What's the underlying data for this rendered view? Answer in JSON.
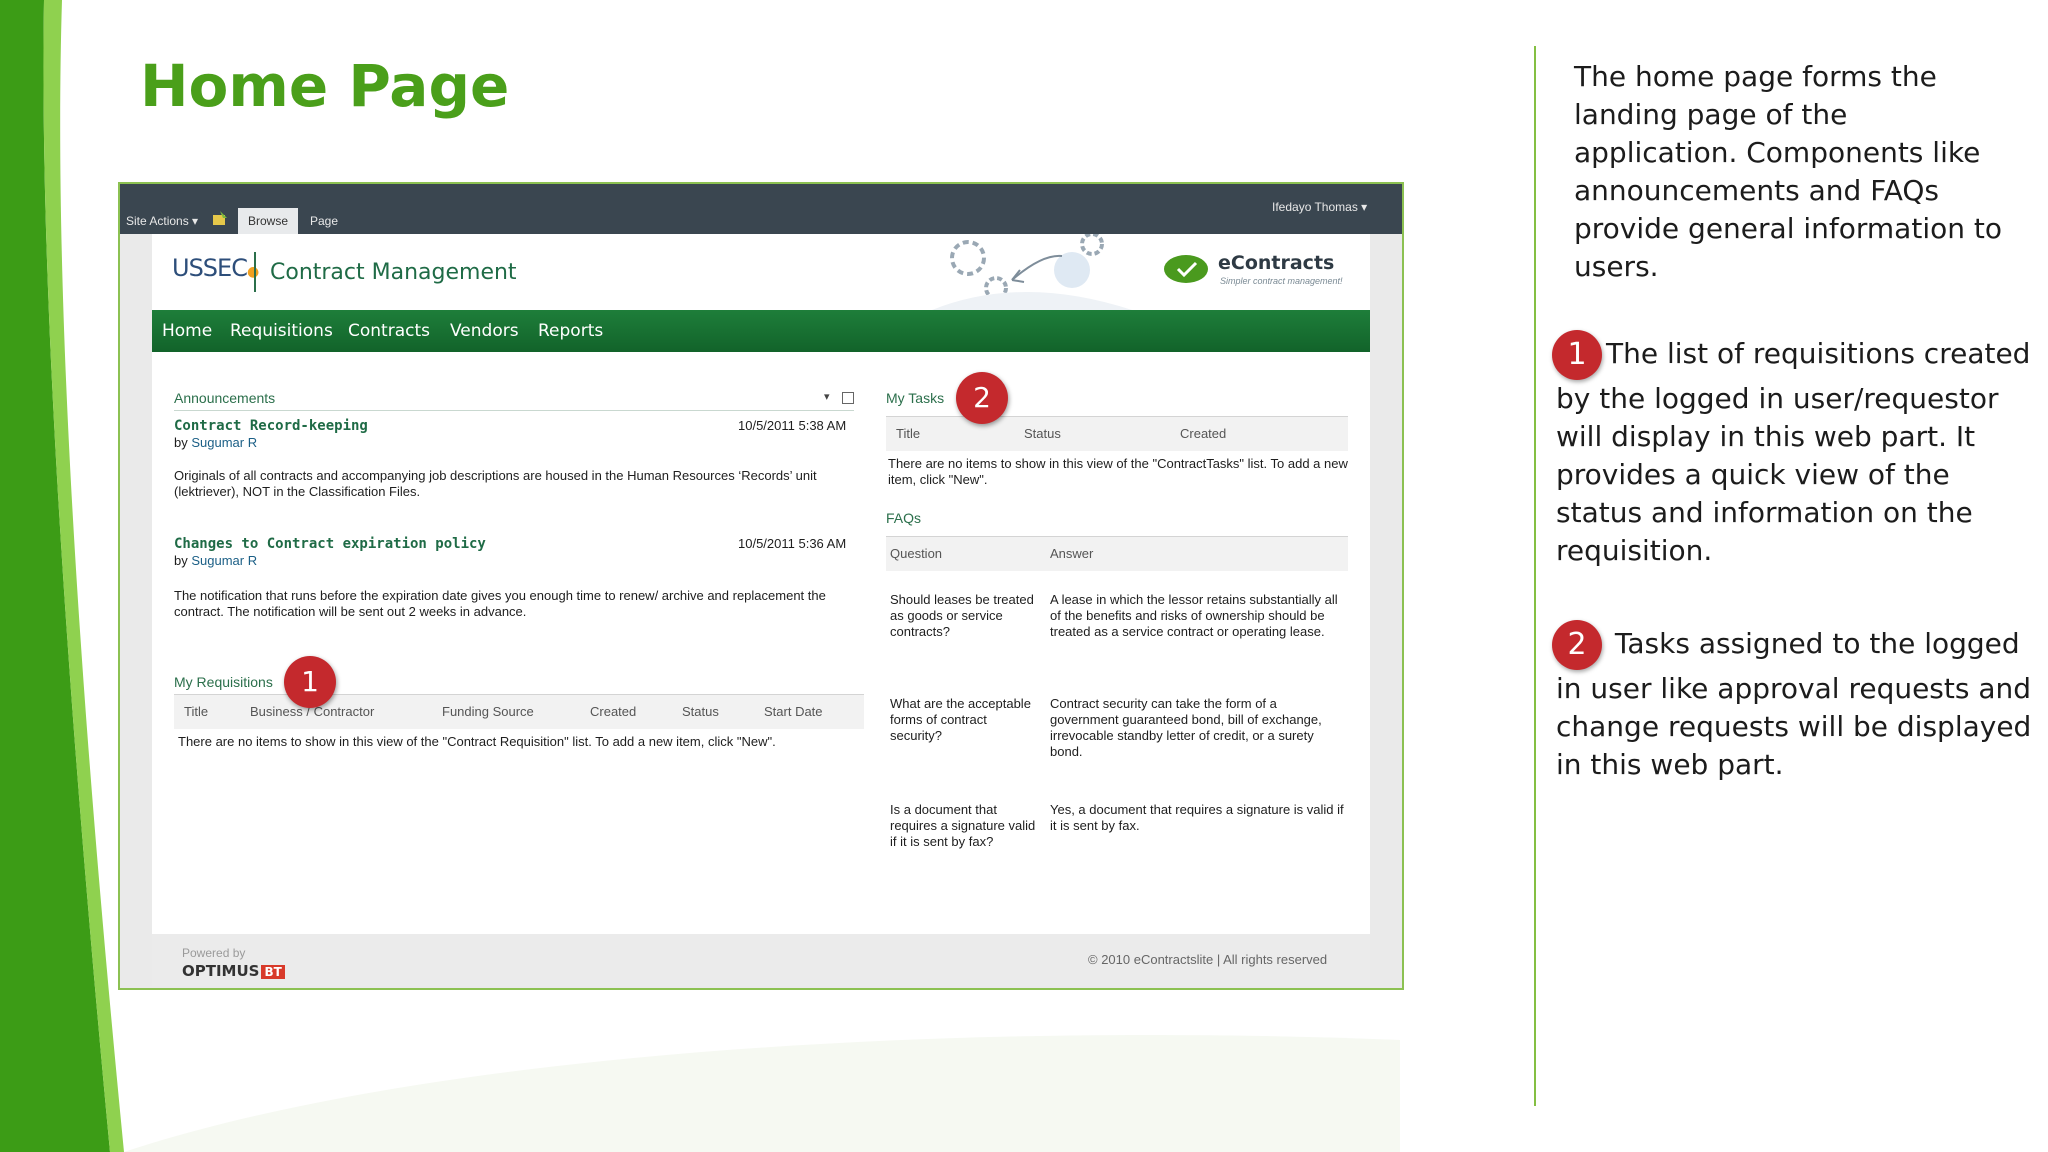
{
  "slide": {
    "title": "Home Page",
    "note_intro": "The home page forms the landing page of the application. Components like announcements and FAQs provide general information to  users.",
    "note_1_badge": "1",
    "note_1_text": "The list of requisitions created by the logged in user/requestor will display in this web part. It provides a quick view of the status and information on the requisition.",
    "note_2_badge": "2",
    "note_2_text": " Tasks assigned to the logged in user like approval requests and change requests will be displayed in this web part."
  },
  "app": {
    "ribbon": {
      "site_actions": "Site Actions",
      "tab_browse": "Browse",
      "tab_page": "Page",
      "user": "Ifedayo Thomas"
    },
    "header": {
      "logo_text": "USSEC",
      "site_title": "Contract Management",
      "brand_name": "eContracts",
      "brand_tagline": "Simpler contract management!"
    },
    "nav": [
      "Home",
      "Requisitions",
      "Contracts",
      "Vendors",
      "Reports"
    ],
    "announcements": {
      "title": "Announcements",
      "items": [
        {
          "title": "Contract Record-keeping",
          "date": "10/5/2011 5:38 AM",
          "by": "by",
          "author": "Sugumar R",
          "body": "Originals of all contracts and accompanying job descriptions are housed in the Human Resources ‘Records’ unit (lektriever), NOT in the Classification Files."
        },
        {
          "title": "Changes to Contract expiration policy",
          "date": "10/5/2011 5:36 AM",
          "by": "by",
          "author": "Sugumar R",
          "body": "The notification that runs before the expiration date gives you enough time to renew/ archive and replacement the contract. The notification will be sent out 2 weeks in advance."
        }
      ]
    },
    "my_requisitions": {
      "title": "My Requisitions",
      "badge": "1",
      "columns": [
        "Title",
        "Business / Contractor",
        "Funding Source",
        "Created",
        "Status",
        "Start Date"
      ],
      "empty": "There are no items to show in this view of the \"Contract Requisition\" list. To add a new item, click \"New\"."
    },
    "my_tasks": {
      "title": "My Tasks",
      "badge": "2",
      "columns": [
        "Title",
        "Status",
        "Created"
      ],
      "empty": "There are no items to show in this view of the \"ContractTasks\" list. To add a new item, click \"New\"."
    },
    "faqs": {
      "title": "FAQs",
      "columns": [
        "Question",
        "Answer"
      ],
      "rows": [
        {
          "q": "Should leases be treated as goods or service contracts?",
          "a": "A lease in which the lessor retains substantially all of the benefits and risks of ownership should be treated as a service contract or operating lease."
        },
        {
          "q": "What are the acceptable forms of contract security?",
          "a": "Contract security can take the form of a government guaranteed bond, bill of exchange, irrevocable standby letter of credit, or a surety bond."
        },
        {
          "q": "Is a document that requires a signature valid if it is sent by fax?",
          "a": "Yes, a document that requires a signature is valid if it is sent by fax."
        }
      ]
    },
    "footer": {
      "powered_by": "Powered by",
      "vendor_name": "OPTIMUS",
      "vendor_badge": "BT",
      "copyright": "© 2010 eContractslite | All rights reserved"
    }
  }
}
